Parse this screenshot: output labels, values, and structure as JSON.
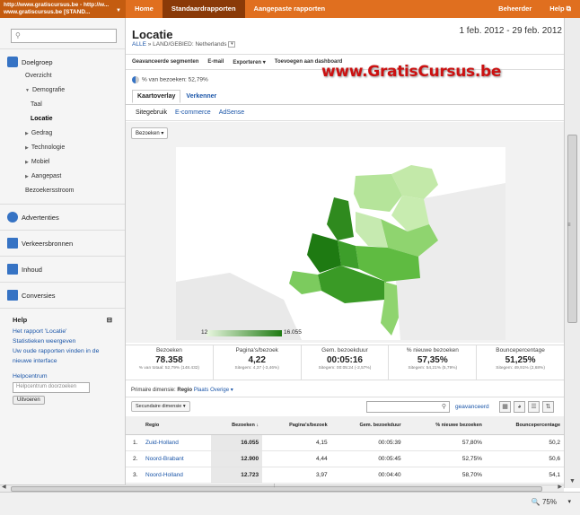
{
  "header": {
    "account_line1": "http://www.gratiscursus.be - http://w...",
    "account_line2": "www.gratiscursus.be [STAND...",
    "tabs": [
      "Home",
      "Standaardrapporten",
      "Aangepaste rapporten"
    ],
    "right": [
      "Beheerder",
      "Help"
    ]
  },
  "sidebar": {
    "search_placeholder": "",
    "doelgroep": "Doelgroep",
    "items": [
      {
        "label": "Overzicht"
      },
      {
        "label": "Demografie"
      },
      {
        "label": "Taal"
      },
      {
        "label": "Locatie"
      },
      {
        "label": "Gedrag"
      },
      {
        "label": "Technologie"
      },
      {
        "label": "Mobiel"
      },
      {
        "label": "Aangepast"
      },
      {
        "label": "Bezoekersstroom"
      }
    ],
    "sections": [
      "Advertenties",
      "Verkeersbronnen",
      "Inhoud",
      "Conversies"
    ],
    "help": {
      "title": "Help",
      "links": [
        "Het rapport 'Locatie'",
        "Statistieken weergeven",
        "Uw oude rapporten vinden in de nieuwe interface"
      ],
      "helpcenter": "Helpcentrum",
      "search_placeholder": "Helpcentrum doorzoeken",
      "button": "Uitvoeren"
    }
  },
  "main": {
    "title": "Locatie",
    "breadcrumb_all": "ALLE",
    "breadcrumb_sep": "»",
    "breadcrumb_rest": "LAND/GEBIED: Netherlands",
    "date_range": "1 feb. 2012 - 29 feb. 2012",
    "toolbar": [
      "Geavanceerde segmenten",
      "E-mail",
      "Exporteren ▾",
      "Toevoegen aan dashboard"
    ],
    "watermark": "www.GratisCursus.be",
    "pct_visits": "% van bezoeken: 52,79%",
    "tabs": [
      "Kaartoverlay",
      "Verkenner"
    ],
    "subtabs": [
      "Sitegebruik",
      "E-commerce",
      "AdSense"
    ],
    "map_select": "Bezoeken",
    "legend_min": "12",
    "legend_max": "16.055"
  },
  "metrics": [
    {
      "label": "Bezoeken",
      "value": "78.358",
      "sub": "% van totaal: 52,79% (148.432)"
    },
    {
      "label": "Pagina's/bezoek",
      "value": "4,22",
      "sub": "Sitegem: 4,37 (-3,46%)"
    },
    {
      "label": "Gem. bezoekduur",
      "value": "00:05:16",
      "sub": "Sitegem: 00:05:24 (-2,57%)"
    },
    {
      "label": "% nieuwe bezoeken",
      "value": "57,35%",
      "sub": "Sitegem: 54,21% (5,79%)"
    },
    {
      "label": "Bouncepercentage",
      "value": "51,25%",
      "sub": "Sitegem: 49,91% (2,68%)"
    }
  ],
  "dimension": {
    "primary_label": "Primaire dimensie:",
    "options": [
      "Regio",
      "Plaats",
      "Overige ▾"
    ],
    "secondary": "Secundaire dimensie",
    "advanced": "geavanceerd"
  },
  "table": {
    "headers": [
      "Regio",
      "Bezoeken",
      "Pagina's/bezoek",
      "Gem. bezoekduur",
      "% nieuwe bezoeken",
      "Bouncepercentage"
    ],
    "rows": [
      {
        "n": "1.",
        "regio": "Zuid-Holland",
        "bezoeken": "16.055",
        "pagina": "4,15",
        "duur": "00:05:39",
        "nieuw": "57,80%",
        "bounce": "50,2"
      },
      {
        "n": "2.",
        "regio": "Noord-Brabant",
        "bezoeken": "12.900",
        "pagina": "4,44",
        "duur": "00:05:45",
        "nieuw": "52,75%",
        "bounce": "50,6"
      },
      {
        "n": "3.",
        "regio": "Noord-Holland",
        "bezoeken": "12.723",
        "pagina": "3,97",
        "duur": "00:04:40",
        "nieuw": "58,70%",
        "bounce": "54,1"
      }
    ]
  },
  "status": {
    "zoom": "75%"
  },
  "colors": {
    "brand": "#e06f1f",
    "map_high": "#1e7a12",
    "map_low": "#e9f7e0"
  }
}
